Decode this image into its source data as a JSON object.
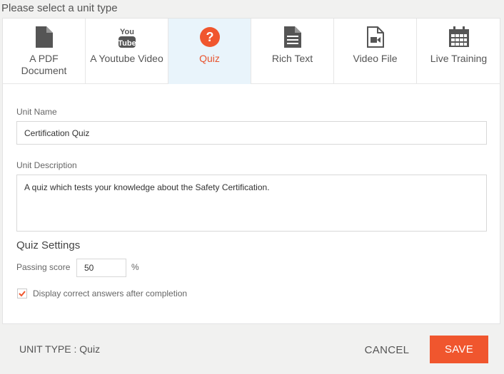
{
  "header": {
    "prompt": "Please select a unit type"
  },
  "unit_types": [
    {
      "label": "A PDF Document",
      "icon": "pdf-document-icon",
      "active": false
    },
    {
      "label": "A Youtube Video",
      "icon": "youtube-icon",
      "active": false
    },
    {
      "label": "Quiz",
      "icon": "question-circle-icon",
      "active": true
    },
    {
      "label": "Rich Text",
      "icon": "text-document-icon",
      "active": false
    },
    {
      "label": "Video File",
      "icon": "video-file-icon",
      "active": false
    },
    {
      "label": "Live Training",
      "icon": "calendar-icon",
      "active": false
    }
  ],
  "form": {
    "unit_name_label": "Unit Name",
    "unit_name_value": "Certification Quiz",
    "unit_description_label": "Unit Description",
    "unit_description_value": "A quiz which tests your knowledge about the Safety Certification."
  },
  "quiz_settings": {
    "title": "Quiz Settings",
    "passing_score_label": "Passing score",
    "passing_score_value": "50",
    "percent_symbol": "%",
    "display_answers_label": "Display correct answers after completion",
    "display_answers_checked": true
  },
  "footer": {
    "unit_type_text": "UNIT TYPE : Quiz",
    "cancel_label": "CANCEL",
    "save_label": "SAVE"
  },
  "colors": {
    "accent": "#f0562e",
    "active_tab_bg": "#e9f4fb",
    "icon_gray": "#555555"
  }
}
